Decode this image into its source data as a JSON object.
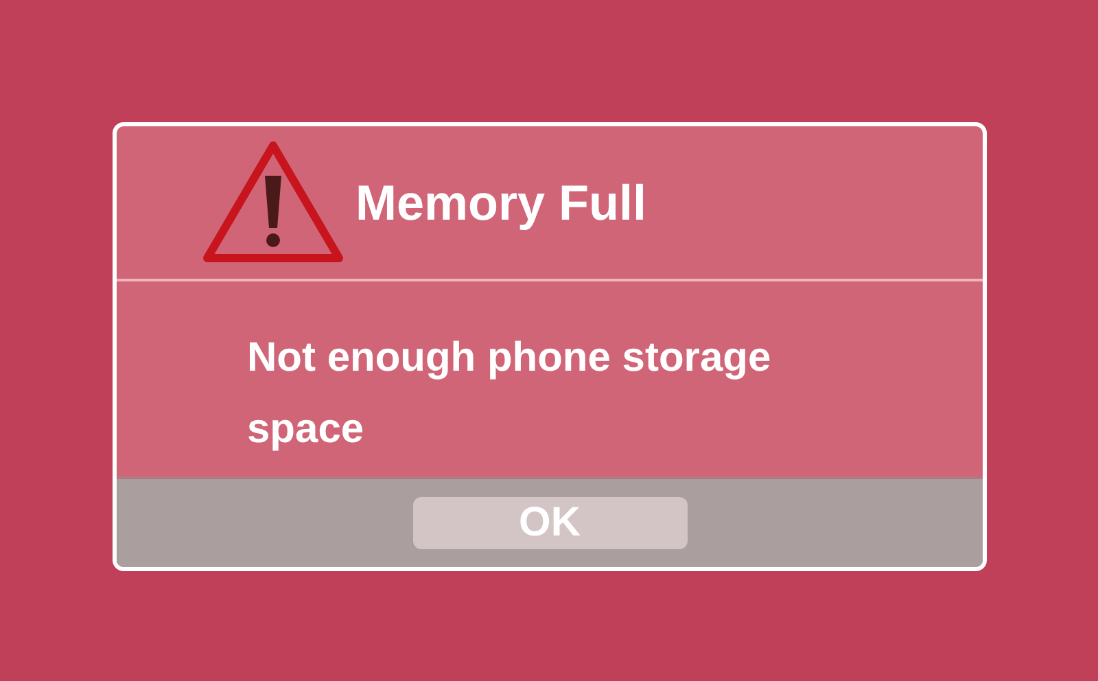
{
  "dialog": {
    "title": "Memory Full",
    "message": "Not enough phone storage space",
    "buttons": [
      "OK"
    ]
  }
}
